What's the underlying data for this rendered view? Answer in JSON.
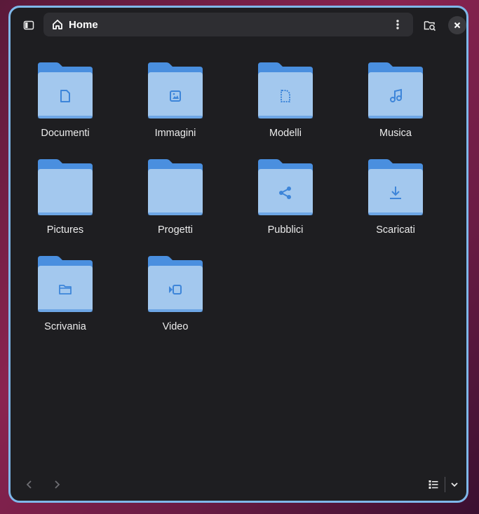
{
  "pathbar": {
    "location": "Home"
  },
  "folders": [
    {
      "label": "Documenti",
      "emblem": "document-icon"
    },
    {
      "label": "Immagini",
      "emblem": "image-icon"
    },
    {
      "label": "Modelli",
      "emblem": "template-icon"
    },
    {
      "label": "Musica",
      "emblem": "music-icon"
    },
    {
      "label": "Pictures",
      "emblem": ""
    },
    {
      "label": "Progetti",
      "emblem": ""
    },
    {
      "label": "Pubblici",
      "emblem": "share-icon"
    },
    {
      "label": "Scaricati",
      "emblem": "download-icon"
    },
    {
      "label": "Scrivania",
      "emblem": "desktop-folder-icon"
    },
    {
      "label": "Video",
      "emblem": "video-icon"
    }
  ],
  "colors": {
    "window_bg": "#1e1e21",
    "window_border": "#7fb8ea",
    "folder_back": "#4a8fdf",
    "folder_front": "#a3c8ee",
    "emblem": "#3d85d9"
  }
}
